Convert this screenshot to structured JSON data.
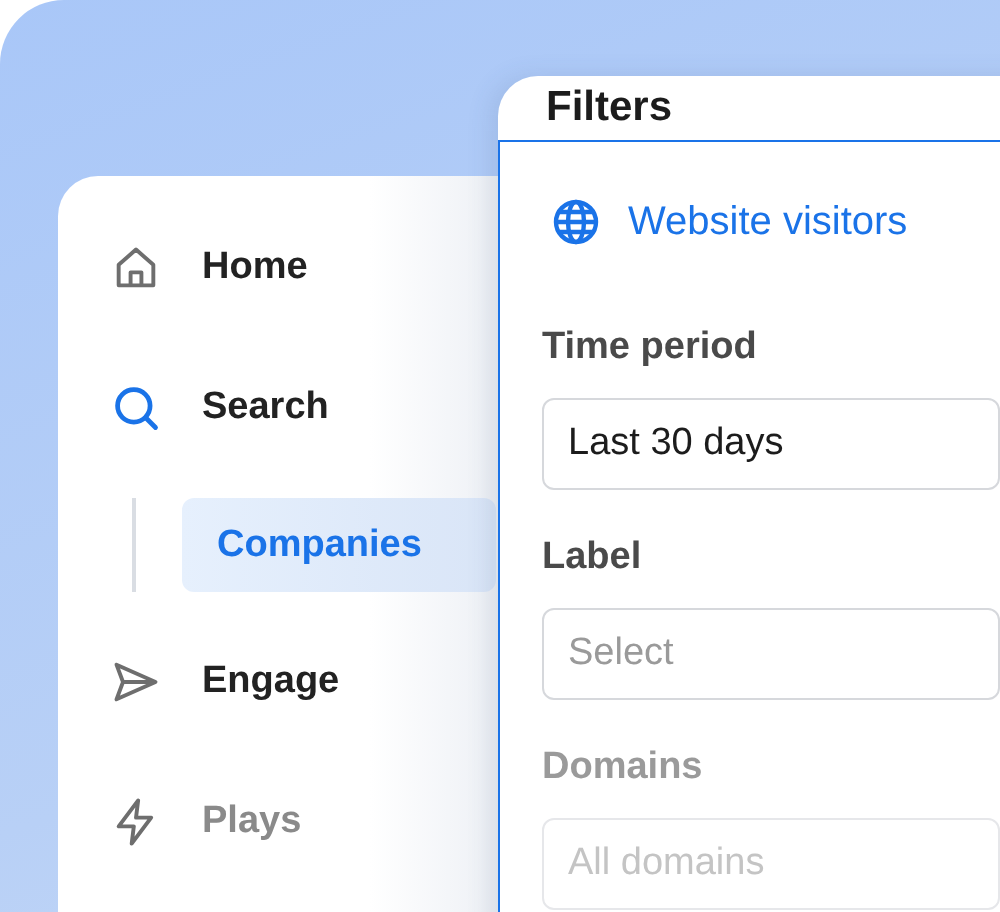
{
  "sidebar": {
    "items": [
      {
        "label": "Home",
        "selected": false
      },
      {
        "label": "Search",
        "selected": false,
        "children": [
          {
            "label": "Companies",
            "selected": true
          }
        ]
      },
      {
        "label": "Engage",
        "selected": false
      },
      {
        "label": "Plays",
        "selected": false
      }
    ]
  },
  "filters": {
    "title": "Filters",
    "source": {
      "label": "Website visitors"
    },
    "fields": [
      {
        "label": "Time period",
        "value": "Last 30 days"
      },
      {
        "label": "Label",
        "placeholder": "Select"
      },
      {
        "label": "Domains",
        "placeholder": "All domains"
      }
    ]
  }
}
